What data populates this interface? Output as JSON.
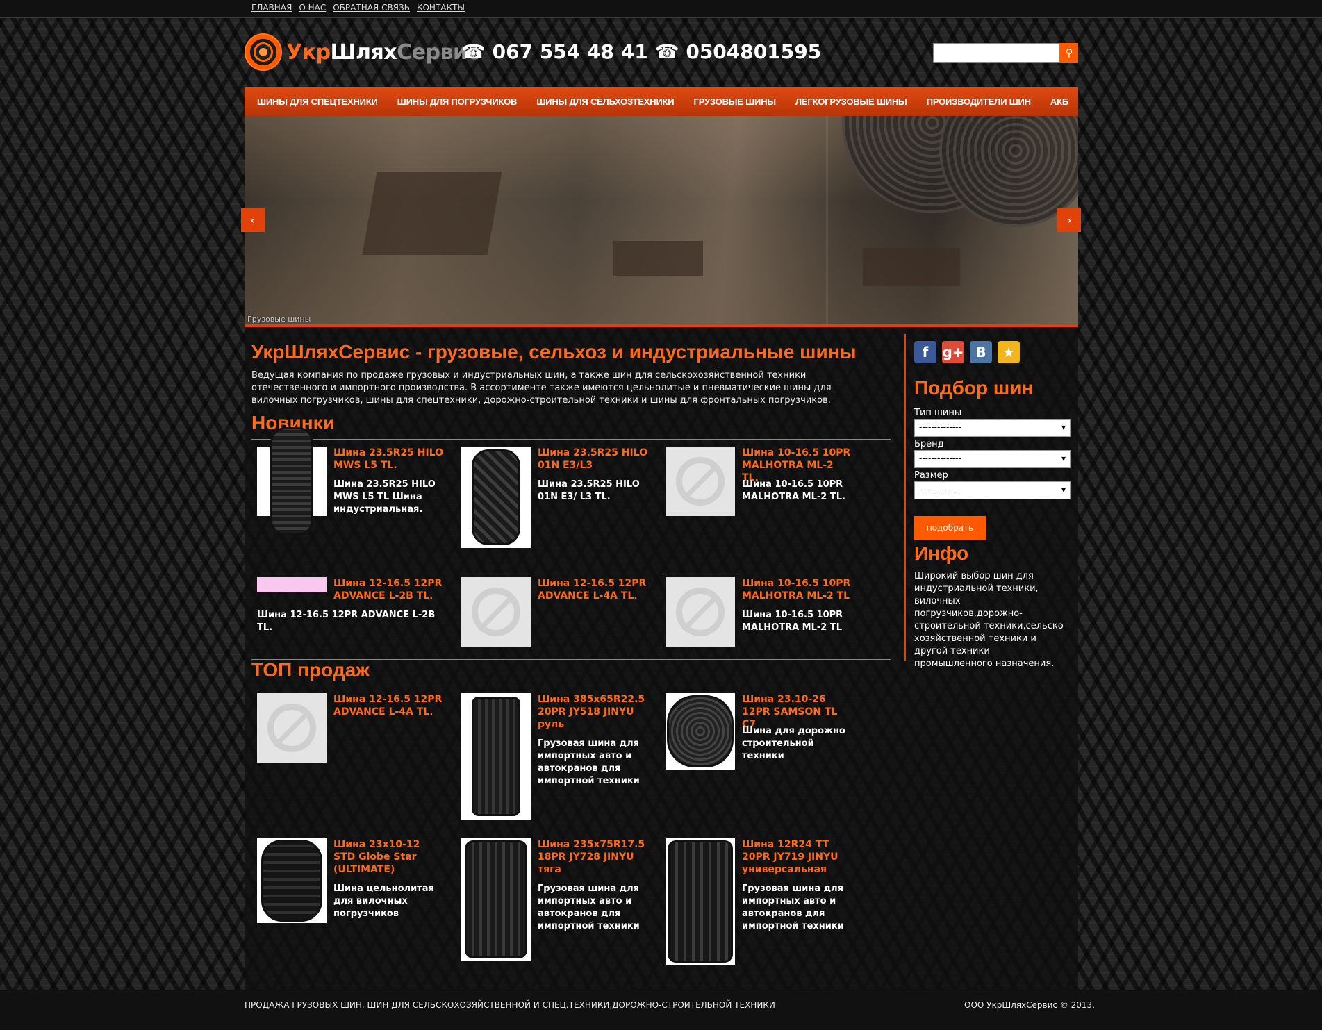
{
  "top_nav": [
    "ГЛАВНАЯ",
    "О НАС",
    "ОБРАТНАЯ СВЯЗЬ",
    "КОНТАКТЫ"
  ],
  "logo": {
    "part1": "Укр",
    "part2": "Шлях",
    "part3": "Сервис"
  },
  "phones": [
    "☎ 067 554 48 41",
    "☎ 0504801595"
  ],
  "search": {
    "placeholder": "",
    "button_icon": "search-icon"
  },
  "main_nav": [
    "ШИНЫ ДЛЯ СПЕЦТЕХНИКИ",
    "ШИНЫ ДЛЯ ПОГРУЗЧИКОВ",
    "ШИНЫ ДЛЯ СЕЛЬХОЗТЕХНИКИ",
    "ГРУЗОВЫЕ ШИНЫ",
    "ЛЕГКОГРУЗОВЫЕ ШИНЫ",
    "ПРОИЗВОДИТЕЛИ ШИН",
    "АКБ"
  ],
  "slider": {
    "caption": "Грузовые шины",
    "prev": "‹",
    "next": "›"
  },
  "page": {
    "title": "УкрШляхСервис - грузовые, сельхоз и индустриальные шины",
    "intro": "Ведущая компания по продаже грузовых и индустриальных шин, а также шин для сельскохозяйственной техники отечественного и импортного производства. В ассортименте также имеются цельнолитые и пневматические шины для вилочных погрузчиков, шины для спецтехники, дорожно-строительной техники и шины для фронтальных погрузчиков."
  },
  "new_section": {
    "title": "Новинки",
    "products": [
      {
        "title": "Шина 23.5R25 HILO MWS L5 TL.",
        "desc": "Шина 23.5R25 HILO MWS L5 TL Шина индустриальная.",
        "image": "tire-tread-icon"
      },
      {
        "title": "Шина 23.5R25 HILO 01N E3/L3",
        "desc": "Шина 23.5R25 HILO 01N E3/ L3 TL.",
        "image": "tire-tread-icon"
      },
      {
        "title": "Шина 10-16.5 10PR MALHOTRA ML-2 TL.",
        "desc": "Шина 10-16.5 10PR MALHOTRA ML-2 TL.",
        "image": "no-image-icon"
      },
      {
        "title": "Шина 12-16.5 12PR ADVANCE L-2B TL.",
        "desc": "Шина 12-16.5 12PR ADVANCE L-2B TL.",
        "image": "broken-image-icon"
      },
      {
        "title": "Шина 12-16.5 12PR ADVANCE L-4A TL.",
        "desc": "",
        "image": "no-image-icon"
      },
      {
        "title": "Шина 10-16.5 10PR MALHOTRA ML-2 TL",
        "desc": "Шина 10-16.5 10PR MALHOTRA ML-2 TL",
        "image": "no-image-icon"
      }
    ]
  },
  "top_section": {
    "title": "ТОП продаж",
    "products": [
      {
        "title": "Шина 12-16.5 12PR ADVANCE L-4A TL.",
        "desc": "",
        "image": "no-image-icon"
      },
      {
        "title": "Шина 385x65R22.5 20PR JY518 JINYU руль",
        "desc": "Грузовая шина для импортных авто и автокранов для импортной техники",
        "image": "truck-tire-icon"
      },
      {
        "title": "Шина 23.10-26 12PR SAMSON TL C7",
        "desc": "Шина для дорожно строительной техники",
        "image": "tire-tread-icon"
      },
      {
        "title": "Шина 23x10-12 STD Globe Star (ULTIMATE)",
        "desc": "Шина цельнолитая для вилочных погрузчиков",
        "image": "solid-tire-icon"
      },
      {
        "title": "Шина 235x75R17.5 18PR JY728 JINYU тяга",
        "desc": "Грузовая шина для импортных авто и автокранов для импортной техники",
        "image": "truck-tire-icon"
      },
      {
        "title": "Шина 12R24 TT 20PR JY719 JINYU универсальная",
        "desc": "Грузовая шина для импортных авто и автокранов для импортной техники",
        "image": "truck-tire-icon"
      }
    ]
  },
  "sidebar": {
    "social": [
      {
        "icon": "facebook-icon",
        "glyph": "f",
        "color": "#3b5998"
      },
      {
        "icon": "google-plus-icon",
        "glyph": "g+",
        "color": "#dd4b39"
      },
      {
        "icon": "vk-icon",
        "glyph": "B",
        "color": "#4c75a3"
      },
      {
        "icon": "bookmark-star-icon",
        "glyph": "★",
        "color": "#f2b51c"
      }
    ],
    "tire_picker": {
      "title": "Подбор шин",
      "type_label": "Тип шины",
      "type_value": "--------------",
      "brand_label": "Бренд",
      "brand_value": "--------------",
      "size_label": "Размер",
      "size_value": "--------------",
      "button": "подобрать"
    },
    "info": {
      "title": "Инфо",
      "text": "Широкий выбор шин для индустриальной техники, вилочных погрузчиков,дорожно-строительной техники,сельско-хозяйственной техники и другой техники промышленного назначения."
    }
  },
  "footer": {
    "left": "ПРОДАЖА ГРУЗОВЫХ ШИН, ШИН ДЛЯ СЕЛЬСКОХОЗЯЙСТВЕННОЙ И СПЕЦ.ТЕХНИКИ,ДОРОЖНО-СТРОИТЕЛЬНОЙ ТЕХНИКИ",
    "right": "ООО УкрШляхСервис © 2013."
  },
  "colors": {
    "accent": "#ff6a1a",
    "nav": "#c83c0a",
    "background": "#262626"
  }
}
